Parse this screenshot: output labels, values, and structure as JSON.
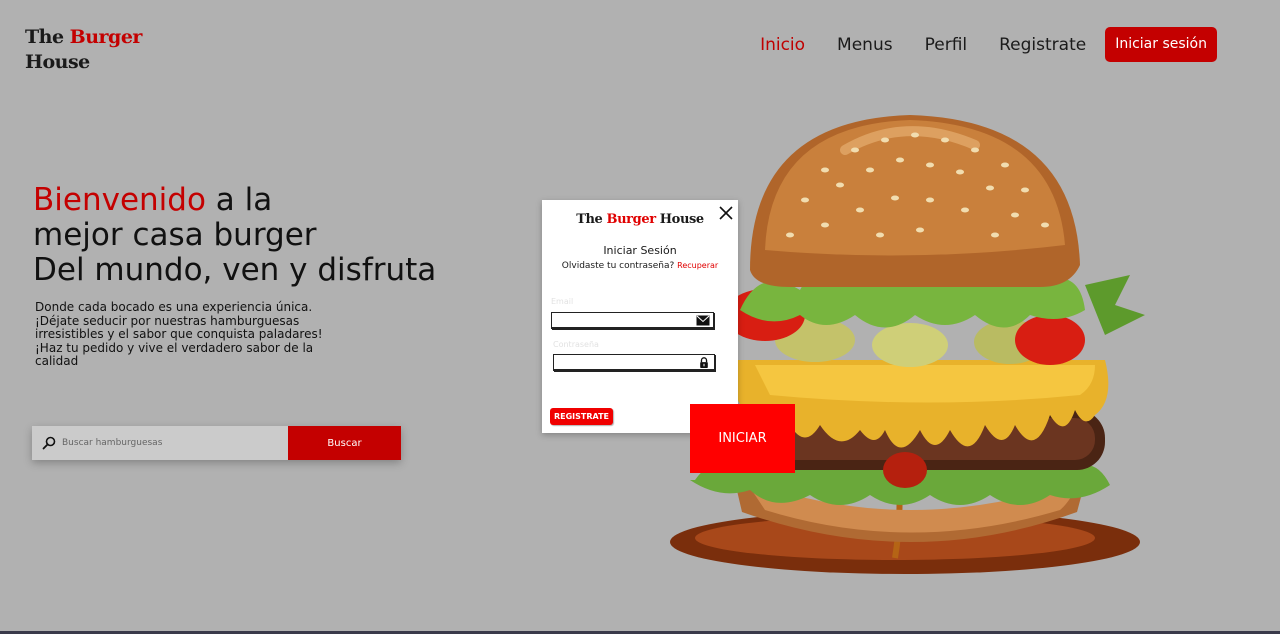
{
  "brand": {
    "word1": "The",
    "word2": "Burger",
    "word3": "House"
  },
  "nav": {
    "items": [
      {
        "label": "Inicio",
        "active": true
      },
      {
        "label": "Menus"
      },
      {
        "label": "Perfil"
      },
      {
        "label": "Registrate"
      }
    ],
    "login_button": "Iniciar sesión"
  },
  "hero": {
    "title_red": "Bienvenido",
    "title_rest": " a la",
    "title_line2": "mejor casa burger",
    "title_line3": "Del mundo, ven y disfruta",
    "subtitle": "Donde cada bocado es una experiencia única. ¡Déjate seducir por nuestras hamburguesas irresistibles y el sabor que conquista paladares! ¡Haz tu pedido y vive el verdadero sabor de la calidad"
  },
  "search": {
    "placeholder": "Buscar hamburguesas",
    "button_label": "Buscar",
    "icon": "search-icon"
  },
  "modal": {
    "logo": {
      "word1": "The",
      "word2": "Burger",
      "word3": "House"
    },
    "title": "Iniciar Sesión",
    "forgot_text": "Olvidaste tu contraseña?",
    "recover_link": "Recuperar",
    "email_label": "Email",
    "password_label": "Contraseña",
    "register_button": "REGISTRATE",
    "submit_button": "INICIAR",
    "icons": [
      "close-icon",
      "mail-icon",
      "lock-icon"
    ]
  },
  "colors": {
    "background": "#b1b1b1",
    "brand_red": "#c40000",
    "bright_red": "#ff0000"
  },
  "illustration": "burger-image"
}
